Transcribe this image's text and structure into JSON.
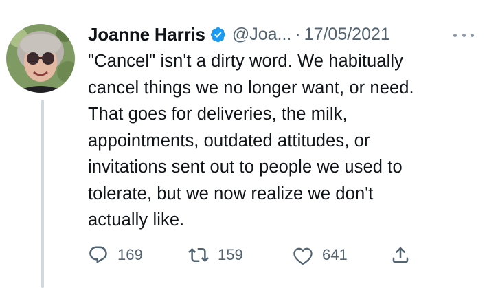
{
  "tweet": {
    "author": {
      "name": "Joanne Harris",
      "handle": "@Joa...",
      "verified": true,
      "avatar": "profile-photo"
    },
    "separator": "·",
    "date": "17/05/2021",
    "text": "\"Cancel\" isn't a dirty word. We habitually\ncancel things we no longer want, or need.\nThat goes for deliveries, the milk,\nappointments, outdated attitudes, or\ninvitations sent out to people we used to\ntolerate, but we now realize we don't\nactually like.",
    "metrics": {
      "replies": "169",
      "retweets": "159",
      "likes": "641"
    },
    "icons": {
      "reply": "speech-bubble-icon",
      "retweet": "retweet-arrows-icon",
      "like": "heart-icon",
      "share": "share-upload-icon",
      "more": "more-dots-icon",
      "verified": "verified-badge-icon"
    },
    "colors": {
      "verified_badge": "#1d9bf0",
      "text_primary": "#0f1419",
      "text_secondary": "#536471",
      "thread_line": "#cfd9de"
    }
  }
}
